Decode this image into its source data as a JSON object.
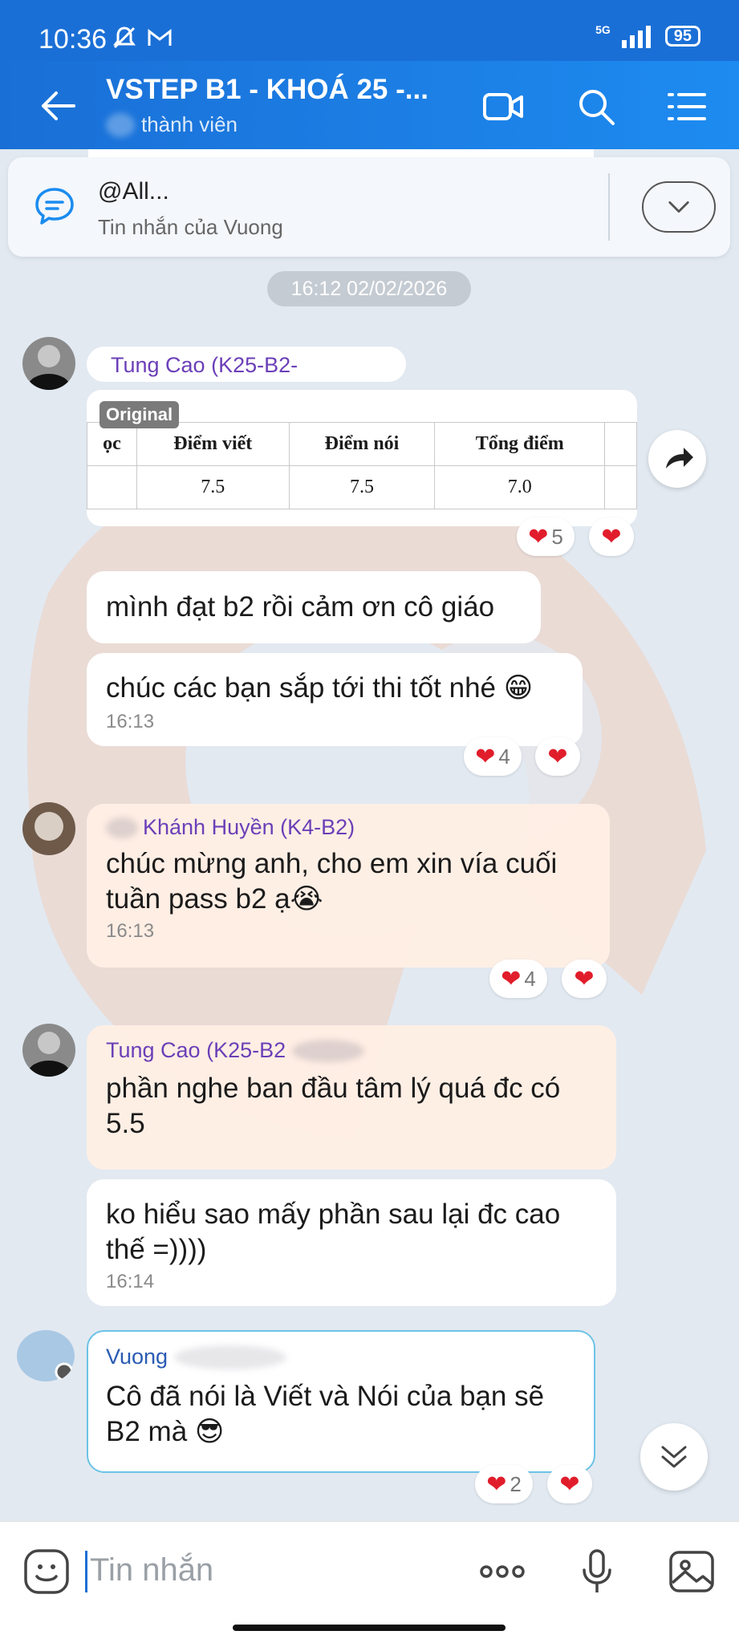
{
  "status_bar": {
    "time": "10:36",
    "network": "5G",
    "battery": "95"
  },
  "header": {
    "title": "VSTEP B1 - KHOÁ 25 -...",
    "subtitle": "thành viên"
  },
  "pinned": {
    "title": "@All...",
    "subtitle": "Tin nhắn của Vuong"
  },
  "date_separator": "16:12 02/02/2026",
  "messages": {
    "m1": {
      "sender": "Tung Cao (K25-B2-",
      "badge": "Original",
      "table": {
        "headers": [
          "ọc",
          "Điểm viết",
          "Điểm nói",
          "Tổng điểm"
        ],
        "row": [
          "",
          "7.5",
          "7.5",
          "7.0"
        ]
      },
      "reaction_count": "5"
    },
    "m2": {
      "text": "mình đạt b2 rồi cảm ơn cô giáo"
    },
    "m3": {
      "text": "chúc các bạn sắp tới thi tốt nhé 😁",
      "time": "16:13",
      "reaction_count": "4"
    },
    "m4": {
      "sender": "Khánh Huyền (K4-B2)",
      "text": "chúc mừng anh, cho em xin vía cuối tuần pass b2 ạ😭",
      "time": "16:13",
      "reaction_count": "4"
    },
    "m5": {
      "sender": "Tung Cao (K25-B2",
      "text": "phần nghe ban đầu tâm lý quá đc có 5.5"
    },
    "m6": {
      "text": "ko hiểu sao mấy phần sau lại đc cao thế =))))",
      "time": "16:14"
    },
    "m7": {
      "sender": "Vuong",
      "text": "Cô đã nói là Viết và Nói của bạn sẽ B2 mà 😎",
      "reaction_count": "2"
    }
  },
  "composer": {
    "placeholder": "Tin nhắn"
  },
  "colors": {
    "brand": "#1a6fd6",
    "sender": "#6b3fb8",
    "heart": "#e11d2b"
  }
}
